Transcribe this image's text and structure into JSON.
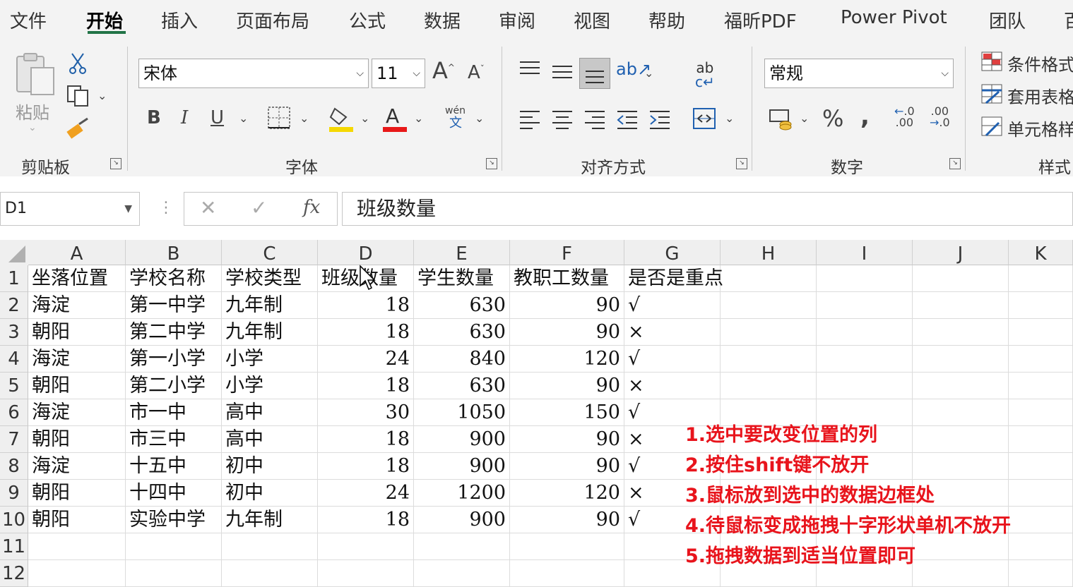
{
  "ribbon": {
    "tabs": [
      "文件",
      "开始",
      "插入",
      "页面布局",
      "公式",
      "数据",
      "审阅",
      "视图",
      "帮助",
      "福昕PDF",
      "Power Pivot",
      "团队",
      "百"
    ],
    "clipboard": {
      "paste_label": "粘贴",
      "group_label": "剪贴板"
    },
    "font": {
      "font_name": "宋体",
      "font_size": "11",
      "phonetic_label": "wén",
      "group_label": "字体",
      "fill_color": "#f5d800",
      "font_color": "#e81818"
    },
    "alignment": {
      "group_label": "对齐方式"
    },
    "number": {
      "format": "常规",
      "group_label": "数字"
    },
    "styles": {
      "conditional_label": "条件格式",
      "table_label": "套用表格",
      "cell_label": "单元格样",
      "group_label": "样式"
    }
  },
  "formula_bar": {
    "name_box": "D1",
    "fx_label": "fx",
    "content": "班级数量"
  },
  "grid": {
    "columns": [
      "A",
      "B",
      "C",
      "D",
      "E",
      "F",
      "G",
      "H",
      "I",
      "J",
      "K"
    ],
    "rows": [
      "1",
      "2",
      "3",
      "4",
      "5",
      "6",
      "7",
      "8",
      "9",
      "10",
      "11",
      "12"
    ],
    "cells": [
      [
        "坐落位置",
        "学校名称",
        "学校类型",
        "班级数量",
        "学生数量",
        "教职工数量",
        "是否是重点"
      ],
      [
        "海淀",
        "第一中学",
        "九年制",
        "18",
        "630",
        "90",
        "√"
      ],
      [
        "朝阳",
        "第二中学",
        "九年制",
        "18",
        "630",
        "90",
        "×"
      ],
      [
        "海淀",
        "第一小学",
        "小学",
        "24",
        "840",
        "120",
        "√"
      ],
      [
        "朝阳",
        "第二小学",
        "小学",
        "18",
        "630",
        "90",
        "×"
      ],
      [
        "海淀",
        "市一中",
        "高中",
        "30",
        "1050",
        "150",
        "√"
      ],
      [
        "朝阳",
        "市三中",
        "高中",
        "18",
        "900",
        "90",
        "×"
      ],
      [
        "海淀",
        "十五中",
        "初中",
        "18",
        "900",
        "90",
        "√"
      ],
      [
        "朝阳",
        "十四中",
        "初中",
        "24",
        "1200",
        "120",
        "×"
      ],
      [
        "朝阳",
        "实验中学",
        "九年制",
        "18",
        "900",
        "90",
        "√"
      ]
    ]
  },
  "notes": [
    "1.选中要改变位置的列",
    "2.按住shift键不放开",
    "3.鼠标放到选中的数据边框处",
    "4.待鼠标变成拖拽十字形状单机不放开",
    "5.拖拽数据到适当位置即可"
  ],
  "colors": {
    "accent": "#217346",
    "note_text": "#e8141c"
  }
}
